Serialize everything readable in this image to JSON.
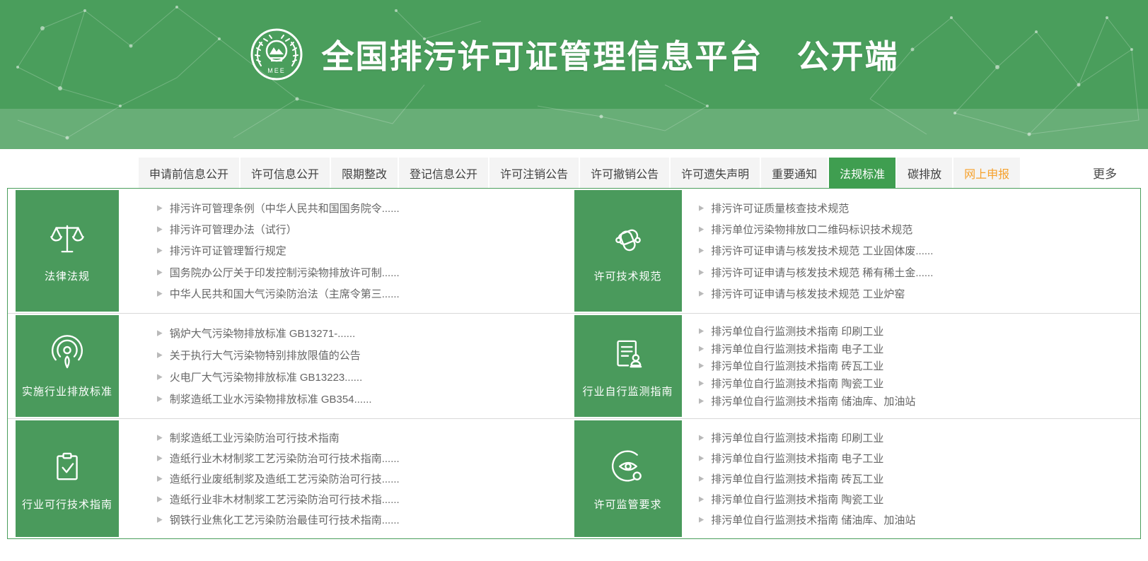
{
  "header": {
    "title": "全国排污许可证管理信息平台　公开端",
    "logo_text": "MEE",
    "colors": {
      "header_green": "#4a9e5c",
      "band_green": "#6fb37d",
      "accent_orange": "#f6a12c"
    }
  },
  "tabs": {
    "items": [
      {
        "id": "pre-application-info",
        "label": "申请前信息公开",
        "active": false,
        "highlight": false
      },
      {
        "id": "permit-info",
        "label": "许可信息公开",
        "active": false,
        "highlight": false
      },
      {
        "id": "deadline-rectification",
        "label": "限期整改",
        "active": false,
        "highlight": false
      },
      {
        "id": "registration-info",
        "label": "登记信息公开",
        "active": false,
        "highlight": false
      },
      {
        "id": "permit-cancellation-notice",
        "label": "许可注销公告",
        "active": false,
        "highlight": false
      },
      {
        "id": "permit-revocation-notice",
        "label": "许可撤销公告",
        "active": false,
        "highlight": false
      },
      {
        "id": "permit-loss-statement",
        "label": "许可遗失声明",
        "active": false,
        "highlight": false
      },
      {
        "id": "important-notice",
        "label": "重要通知",
        "active": false,
        "highlight": false
      },
      {
        "id": "regulations-standards",
        "label": "法规标准",
        "active": true,
        "highlight": false
      },
      {
        "id": "carbon-emission",
        "label": "碳排放",
        "active": false,
        "highlight": false
      },
      {
        "id": "online-declaration",
        "label": "网上申报",
        "active": false,
        "highlight": true
      }
    ],
    "more_label": "更多"
  },
  "sections": [
    {
      "id": "laws-regulations",
      "title": "法律法规",
      "icon": "scales-icon",
      "items": [
        "排污许可管理条例（中华人民共和国国务院令......",
        "排污许可管理办法（试行）",
        "排污许可证管理暂行规定",
        "国务院办公厅关于印发控制污染物排放许可制......",
        "中华人民共和国大气污染防治法（主席令第三......"
      ]
    },
    {
      "id": "permit-technical-specs",
      "title": "许可技术规范",
      "icon": "links-icon",
      "items": [
        "排污许可证质量核查技术规范",
        "排污单位污染物排放口二维码标识技术规范",
        "排污许可证申请与核发技术规范 工业固体废......",
        "排污许可证申请与核发技术规范 稀有稀土金......",
        "排污许可证申请与核发技术规范 工业炉窑"
      ]
    },
    {
      "id": "industry-emission-standards",
      "title": "实施行业排放标准",
      "icon": "broadcast-icon",
      "items": [
        "锅炉大气污染物排放标准 GB13271-......",
        "关于执行大气污染物特别排放限值的公告",
        "火电厂大气污染物排放标准 GB13223......",
        "制浆造纸工业水污染物排放标准 GB354......"
      ]
    },
    {
      "id": "industry-self-monitoring-guides",
      "title": "行业自行监测指南",
      "icon": "document-stamp-icon",
      "items": [
        "排污单位自行监测技术指南 印刷工业",
        "排污单位自行监测技术指南 电子工业",
        "排污单位自行监测技术指南 砖瓦工业",
        "排污单位自行监测技术指南 陶瓷工业",
        "排污单位自行监测技术指南 储油库、加油站"
      ]
    },
    {
      "id": "industry-feasible-tech-guides",
      "title": "行业可行技术指南",
      "icon": "clipboard-check-icon",
      "items": [
        "制浆造纸工业污染防治可行技术指南",
        "造纸行业木材制浆工艺污染防治可行技术指南......",
        "造纸行业废纸制浆及造纸工艺污染防治可行技......",
        "造纸行业非木材制浆工艺污染防治可行技术指......",
        "钢铁行业焦化工艺污染防治最佳可行技术指南......"
      ]
    },
    {
      "id": "permit-supervision-requirements",
      "title": "许可监管要求",
      "icon": "monitor-eye-icon",
      "items": [
        "排污单位自行监测技术指南 印刷工业",
        "排污单位自行监测技术指南 电子工业",
        "排污单位自行监测技术指南 砖瓦工业",
        "排污单位自行监测技术指南 陶瓷工业",
        "排污单位自行监测技术指南 储油库、加油站"
      ]
    }
  ]
}
